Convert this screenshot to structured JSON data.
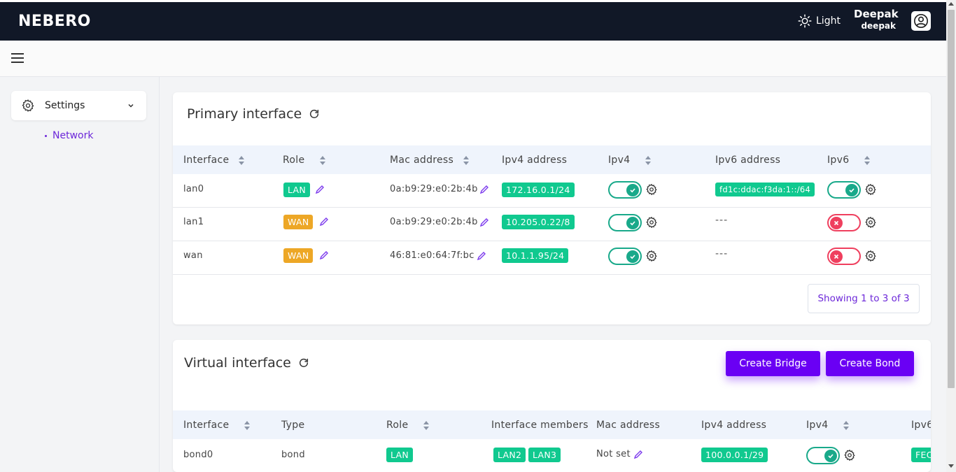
{
  "app": {
    "brand": "NEBERO"
  },
  "header": {
    "theme_label": "Light",
    "user_name": "Deepak",
    "user_login": "deepak"
  },
  "sidebar": {
    "settings_label": "Settings",
    "items": [
      {
        "label": "Network"
      }
    ]
  },
  "primary": {
    "title": "Primary interface",
    "columns": [
      "Interface",
      "Role",
      "Mac address",
      "Ipv4 address",
      "Ipv4",
      "Ipv6 address",
      "Ipv6"
    ],
    "rows": [
      {
        "interface": "lan0",
        "role": "LAN",
        "mac": "0a:b9:29:e0:2b:4b",
        "ipv4_address": "172.16.0.1/24",
        "ipv4_enabled": true,
        "ipv6_address": "fd1c:ddac:f3da:1::/64",
        "ipv6_enabled": true
      },
      {
        "interface": "lan1",
        "role": "WAN",
        "mac": "0a:b9:29:e0:2b:4b",
        "ipv4_address": "10.205.0.22/8",
        "ipv4_enabled": true,
        "ipv6_address": "---",
        "ipv6_enabled": false
      },
      {
        "interface": "wan",
        "role": "WAN",
        "mac": "46:81:e0:64:7f:bc",
        "ipv4_address": "10.1.1.95/24",
        "ipv4_enabled": true,
        "ipv6_address": "---",
        "ipv6_enabled": false
      }
    ],
    "pagination": "Showing 1 to 3 of 3"
  },
  "virtual": {
    "title": "Virtual interface",
    "create_bridge": "Create Bridge",
    "create_bond": "Create Bond",
    "columns": [
      "Interface",
      "Type",
      "Role",
      "Interface members",
      "Mac address",
      "Ipv4 address",
      "Ipv4",
      "Ipv6"
    ],
    "rows": [
      {
        "interface": "bond0",
        "type": "bond",
        "role": "LAN",
        "members": [
          "LAN2",
          "LAN3"
        ],
        "mac": "Not set",
        "ipv4_address": "100.0.0.1/29",
        "ipv4_enabled": true,
        "ipv6_address": "FEC"
      }
    ]
  },
  "colors": {
    "topbar": "#111827",
    "accent": "#6a00f4",
    "green": "#10c98f",
    "amber": "#eda726",
    "toggle_on": "#19a98a",
    "toggle_off": "#ef3f5e"
  }
}
